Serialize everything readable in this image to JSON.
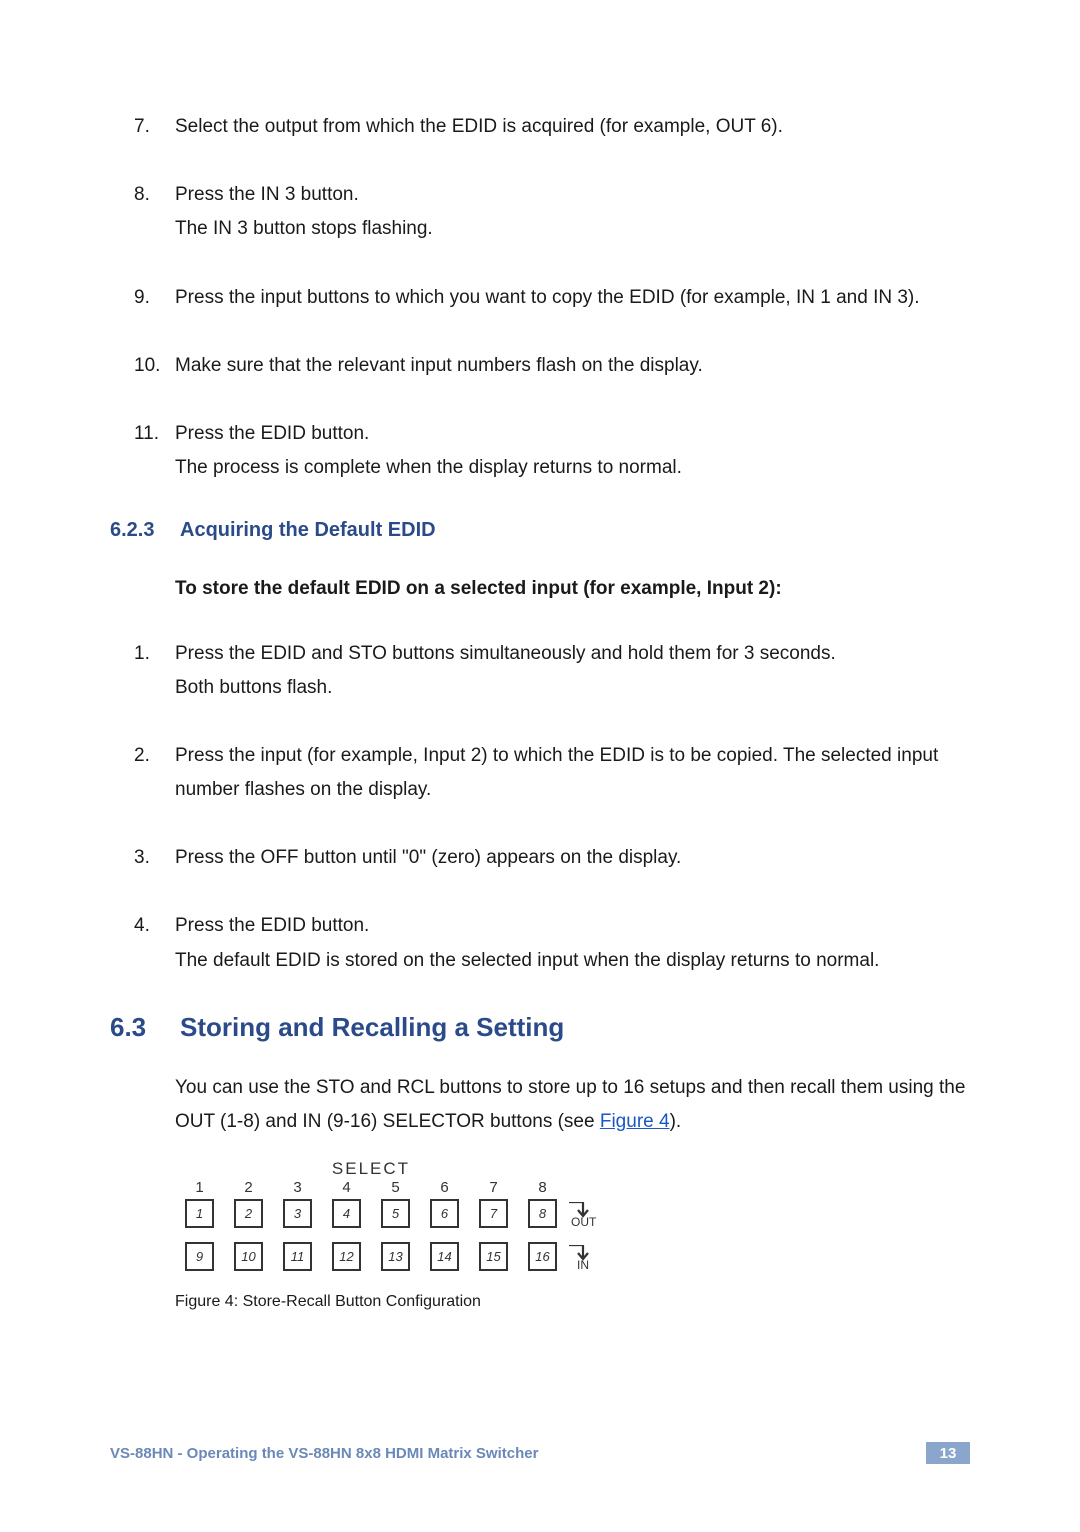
{
  "list1": {
    "items": [
      {
        "num": "7.",
        "lines": [
          "Select the output from which the EDID is acquired (for example, OUT 6)."
        ]
      },
      {
        "num": "8.",
        "lines": [
          "Press the IN 3 button.",
          "The IN 3 button stops flashing."
        ]
      },
      {
        "num": "9.",
        "lines": [
          "Press the input buttons to which you want to copy the EDID (for example, IN 1 and IN 3)."
        ]
      },
      {
        "num": "10.",
        "lines": [
          "Make sure that the relevant input numbers flash on the display."
        ]
      },
      {
        "num": "11.",
        "lines": [
          "Press the EDID button.",
          "The process is complete when the display returns to normal."
        ]
      }
    ]
  },
  "section623": {
    "num": "6.2.3",
    "title": "Acquiring the Default EDID",
    "intro": "To store the default EDID on a selected input (for example, Input 2):",
    "items": [
      {
        "num": "1.",
        "lines": [
          "Press the EDID and STO buttons simultaneously and hold them for 3 seconds.",
          "Both buttons flash."
        ]
      },
      {
        "num": "2.",
        "lines": [
          "Press the input (for example, Input 2) to which the EDID is to be copied. The selected input number flashes on the display."
        ]
      },
      {
        "num": "3.",
        "lines": [
          "Press the OFF button until \"0\" (zero) appears on the display."
        ]
      },
      {
        "num": "4.",
        "lines": [
          "Press the EDID button.",
          "The default EDID is stored on the selected input when the display returns to normal."
        ]
      }
    ]
  },
  "section63": {
    "num": "6.3",
    "title": "Storing and Recalling a Setting",
    "para_before_link": "You can use the STO and RCL buttons to store up to 16 setups and then recall them using the OUT (1-8) and IN (9-16) SELECTOR buttons (see ",
    "link_text": "Figure 4",
    "para_after_link": ")."
  },
  "panel": {
    "title": "SELECT",
    "out_label": "OUT",
    "in_label": "IN",
    "top_row": [
      {
        "seg": "1",
        "btn": "1"
      },
      {
        "seg": "2",
        "btn": "2"
      },
      {
        "seg": "3",
        "btn": "3"
      },
      {
        "seg": "4",
        "btn": "4"
      },
      {
        "seg": "5",
        "btn": "5"
      },
      {
        "seg": "6",
        "btn": "6"
      },
      {
        "seg": "7",
        "btn": "7"
      },
      {
        "seg": "8",
        "btn": "8"
      }
    ],
    "bottom_row": [
      {
        "btn": "9"
      },
      {
        "btn": "10"
      },
      {
        "btn": "11"
      },
      {
        "btn": "12"
      },
      {
        "btn": "13"
      },
      {
        "btn": "14"
      },
      {
        "btn": "15"
      },
      {
        "btn": "16"
      }
    ]
  },
  "caption": "Figure 4: Store-Recall Button Configuration",
  "footer": {
    "text": "VS-88HN - Operating the VS-88HN 8x8 HDMI Matrix Switcher",
    "page": "13"
  }
}
